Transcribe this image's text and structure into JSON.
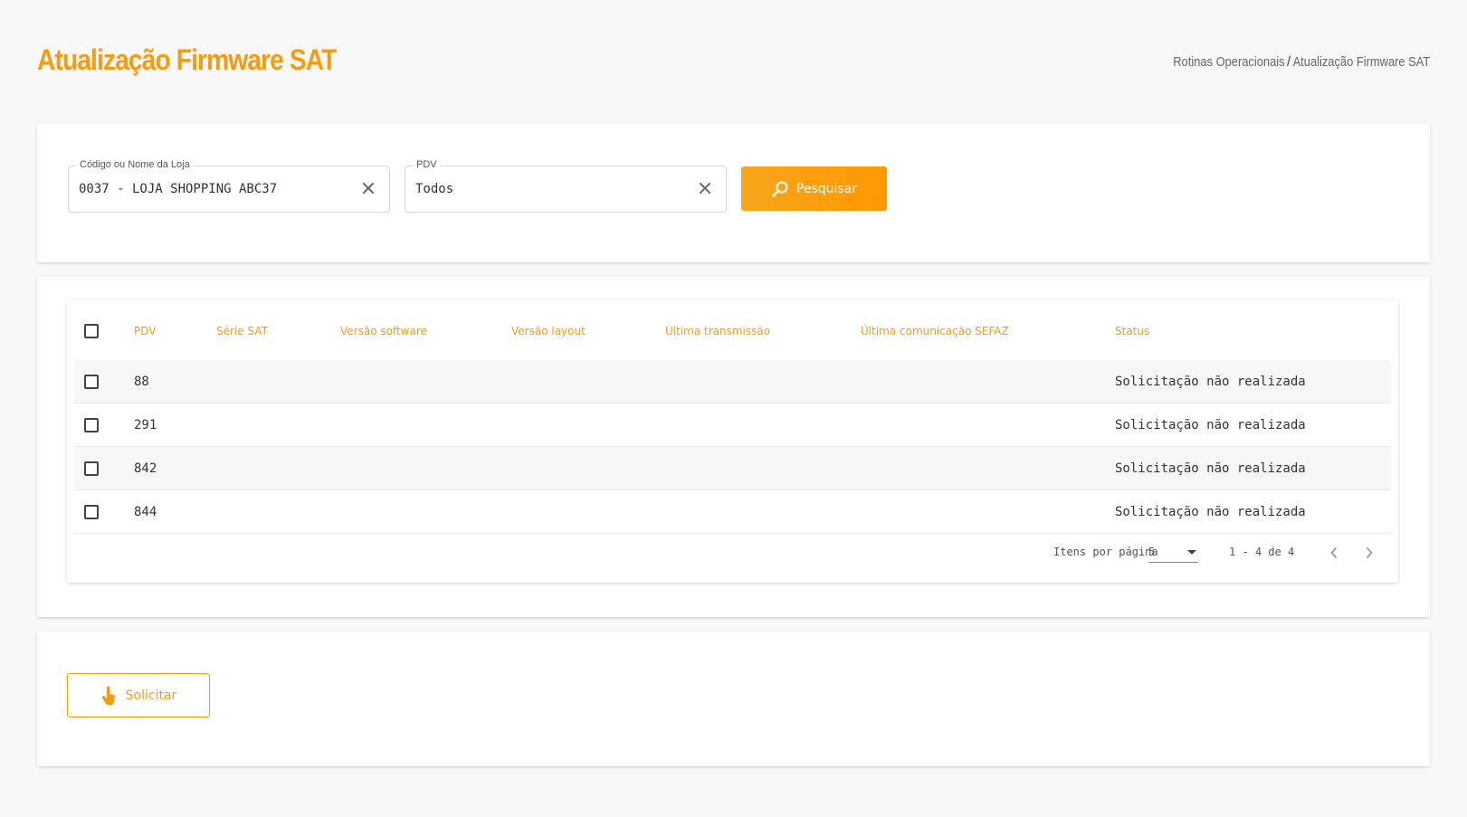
{
  "header": {
    "title": "Atualização Firmware SAT",
    "breadcrumb": [
      "Rotinas Operacionais",
      "Atualização Firmware SAT"
    ],
    "breadcrumb_separator": "/"
  },
  "filters": {
    "loja": {
      "label": "Código ou Nome da Loja",
      "value": "0037 - LOJA SHOPPING ABC37"
    },
    "pdv": {
      "label": "PDV",
      "value": "Todos"
    },
    "search_button": "Pesquisar"
  },
  "table": {
    "columns": [
      "PDV",
      "Série SAT",
      "Versão software",
      "Versão layout",
      "Última transmissão",
      "Última comunicação SEFAZ",
      "Status"
    ],
    "rows": [
      {
        "pdv": "88",
        "status": "Solicitação não realizada"
      },
      {
        "pdv": "291",
        "status": "Solicitação não realizada"
      },
      {
        "pdv": "842",
        "status": "Solicitação não realizada"
      },
      {
        "pdv": "844",
        "status": "Solicitação não realizada"
      }
    ]
  },
  "paginator": {
    "items_per_page_label": "Itens por página",
    "items_per_page": "5",
    "range": "1 - 4 de 4"
  },
  "actions": {
    "solicitar_button": "Solicitar"
  },
  "colors": {
    "accent": "#f39c12",
    "button_orange": "#ff9800"
  },
  "icons": {
    "search": "search-icon",
    "clear": "close-icon",
    "prev": "chevron-left-icon",
    "next": "chevron-right-icon",
    "hand": "hand-pointer-icon"
  }
}
